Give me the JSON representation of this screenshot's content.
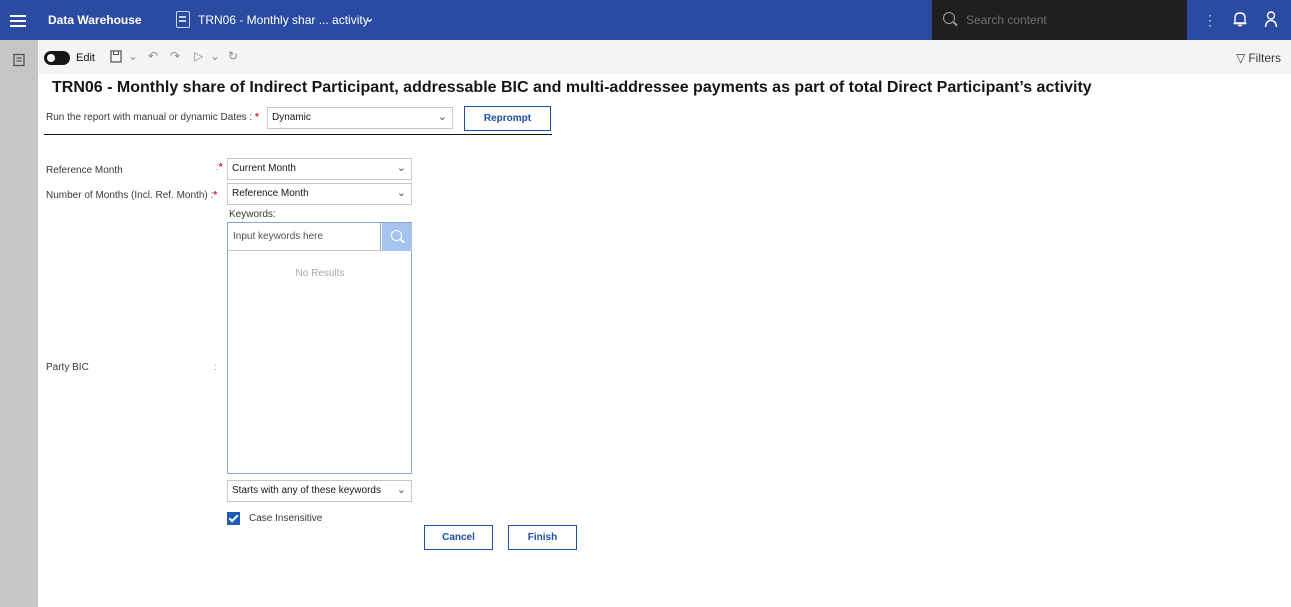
{
  "topbar": {
    "app_title": "Data Warehouse",
    "document_tab": "TRN06 - Monthly shar ... activity",
    "search_placeholder": "Search content",
    "kebab": "⋮"
  },
  "toolbar": {
    "edit_label": "Edit",
    "filters_label": "Filters"
  },
  "page": {
    "title": "TRN06 - Monthly share of Indirect Participant, addressable BIC and multi-addressee payments as part of total Direct Participant’s activity"
  },
  "prompt": {
    "dates_label": "Run the report with manual or dynamic Dates :",
    "dates_value": "Dynamic",
    "reprompt_label": "Reprompt",
    "reference_month_label": "Reference Month",
    "reference_month_value": "Current Month",
    "months_label": "Number of Months (Incl. Ref. Month) :",
    "months_value": "Reference Month",
    "party_bic_label": "Party BIC",
    "keywords_label": "Keywords:",
    "keywords_placeholder": "Input keywords here",
    "no_results": "No Results",
    "match_mode": "Starts with any of these keywords",
    "case_insensitive_label": "Case Insensitive",
    "case_insensitive_checked": true,
    "cancel_label": "Cancel",
    "finish_label": "Finish"
  },
  "colors": {
    "topbar_bg": "#2b4ba3",
    "required": "#da1e28",
    "button_text": "#1d4fa3",
    "checkbox": "#1d5bb5"
  },
  "icons": [
    "hamburger-icon",
    "document-icon",
    "chevron-down-icon",
    "search-icon",
    "notification-icon",
    "user-icon",
    "save-icon",
    "undo-icon",
    "redo-icon",
    "run-icon",
    "refresh-icon",
    "filter-icon"
  ]
}
